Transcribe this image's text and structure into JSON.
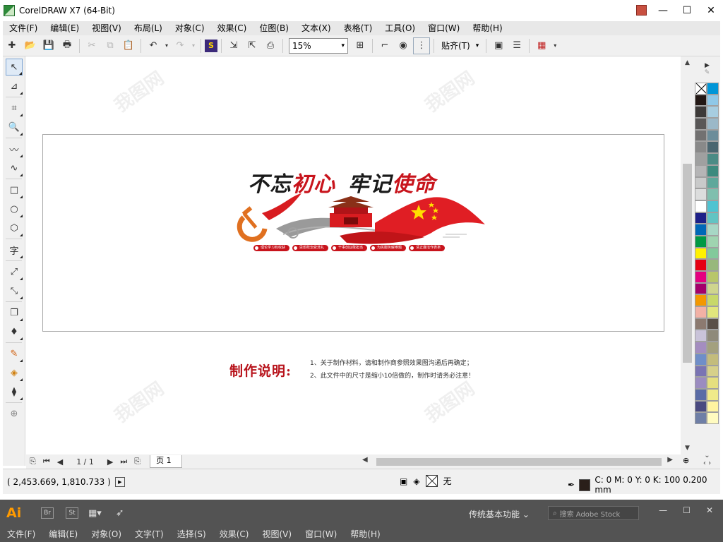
{
  "window": {
    "title": "CorelDRAW X7 (64-Bit)",
    "minimize": "—",
    "maximize": "☐",
    "close": "✕"
  },
  "menu": [
    "文件(F)",
    "编辑(E)",
    "视图(V)",
    "布局(L)",
    "对象(C)",
    "效果(C)",
    "位图(B)",
    "文本(X)",
    "表格(T)",
    "工具(O)",
    "窗口(W)",
    "帮助(H)"
  ],
  "toolbar": {
    "zoom_value": "15%",
    "snap_label": "贴齐(T)"
  },
  "design": {
    "slogan_part1": "不忘",
    "slogan_part2": "初心",
    "slogan_part3": "牢记",
    "slogan_part4": "使命",
    "tags": [
      "理论学习有收获",
      "思想政治受洗礼",
      "干事创业敢担当",
      "为民服务解难题",
      "清正廉洁作表率"
    ]
  },
  "notes": {
    "title": "制作说明:",
    "line1": "1、关于制作材料，请和制作商参照效果图沟通后再确定；",
    "line2": "2、此文件中的尺寸是缩小10倍做的，制作时请务必注意！"
  },
  "page_nav": {
    "counter": "1 / 1",
    "tab": "页 1"
  },
  "palette": {
    "colors": [
      "#ffffff",
      "#0096d8",
      "#231815",
      "#8fc8e8",
      "#3d3a39",
      "#a7cde0",
      "#595757",
      "#9bb8c8",
      "#727171",
      "#6c8d9a",
      "#898989",
      "#4a6670",
      "#9fa0a0",
      "#4b8b85",
      "#b5b5b6",
      "#3d8a7e",
      "#c9caca",
      "#5fa89b",
      "#dcdddd",
      "#7fbfae",
      "#ffffff",
      "#4fc3d1",
      "#1d2088",
      "#62c4c3",
      "#0068b7",
      "#a7d7c5",
      "#009944",
      "#9fd4b0",
      "#fff100",
      "#82c99b",
      "#e60012",
      "#98b87c",
      "#e4007f",
      "#b8c66a",
      "#a4006a",
      "#cfd58e",
      "#f39800",
      "#c7d86a",
      "#f2b1a5",
      "#e1e67d",
      "#8c7a70",
      "#5a5048",
      "#c9c3d9",
      "#8f8a7a",
      "#a48dc0",
      "#a3a07e",
      "#6f8ec8",
      "#c3bc7c",
      "#7a74b3",
      "#d6d08a",
      "#9b8cc0",
      "#e5df7f",
      "#5a6ca6",
      "#f0ea8a",
      "#4a4a80",
      "#fff4a0",
      "#6f7fa6",
      "#fffbc0"
    ]
  },
  "status": {
    "coords": "( 2,453.669, 1,810.733 )",
    "fill_label": "无",
    "outline_label": "C: 0 M: 0 Y: 0 K: 100  0.200 mm"
  },
  "ai_bar": {
    "logo": "Ai",
    "chip1": "Br",
    "chip2": "St",
    "workspace": "传统基本功能",
    "search_placeholder": "搜索 Adobe Stock",
    "menu": [
      "文件(F)",
      "编辑(E)",
      "对象(O)",
      "文字(T)",
      "选择(S)",
      "效果(C)",
      "视图(V)",
      "窗口(W)",
      "帮助(H)"
    ]
  }
}
